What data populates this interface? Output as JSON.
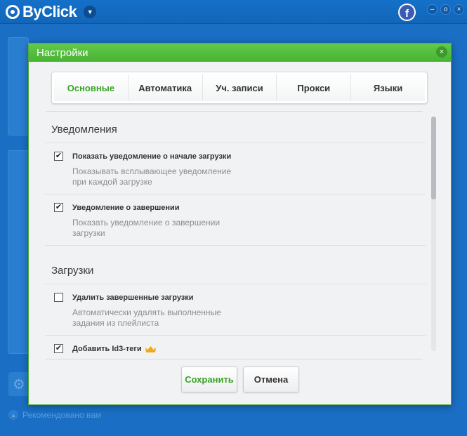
{
  "app": {
    "brand": "ByClick",
    "facebook_glyph": "f",
    "window_controls": [
      "–",
      "o",
      "×"
    ],
    "recommended": "Рекомендовано вам"
  },
  "dialog": {
    "title": "Настройки",
    "close_glyph": "×",
    "tabs": [
      {
        "label": "Основные",
        "active": true
      },
      {
        "label": "Автоматика",
        "active": false
      },
      {
        "label": "Уч. записи",
        "active": false
      },
      {
        "label": "Прокси",
        "active": false
      },
      {
        "label": "Языки",
        "active": false
      }
    ],
    "sections": [
      {
        "title": "Уведомления",
        "settings": [
          {
            "title": "Показать уведомление о начале загрузки",
            "desc": "Показывать всплывающее уведомление при каждой загрузке",
            "checked": true
          },
          {
            "title": "Уведомление о завершении",
            "desc": "Показать уведомление о завершении загрузки",
            "checked": true
          }
        ]
      },
      {
        "title": "Загрузки",
        "settings": [
          {
            "title": "Удалить завершенные загрузки",
            "desc": "Автоматически удалять выполненные задания из плейлиста",
            "checked": false
          },
          {
            "title": "Добавить Id3-теги",
            "desc": "",
            "checked": true,
            "premium_icon": "crown-icon"
          }
        ]
      }
    ],
    "save_label": "Сохранить",
    "cancel_label": "Отмена"
  },
  "colors": {
    "accent_green": "#3aa324",
    "header_green": "#49b333",
    "app_blue": "#1a6fc4",
    "crown": "#f2a81d"
  }
}
